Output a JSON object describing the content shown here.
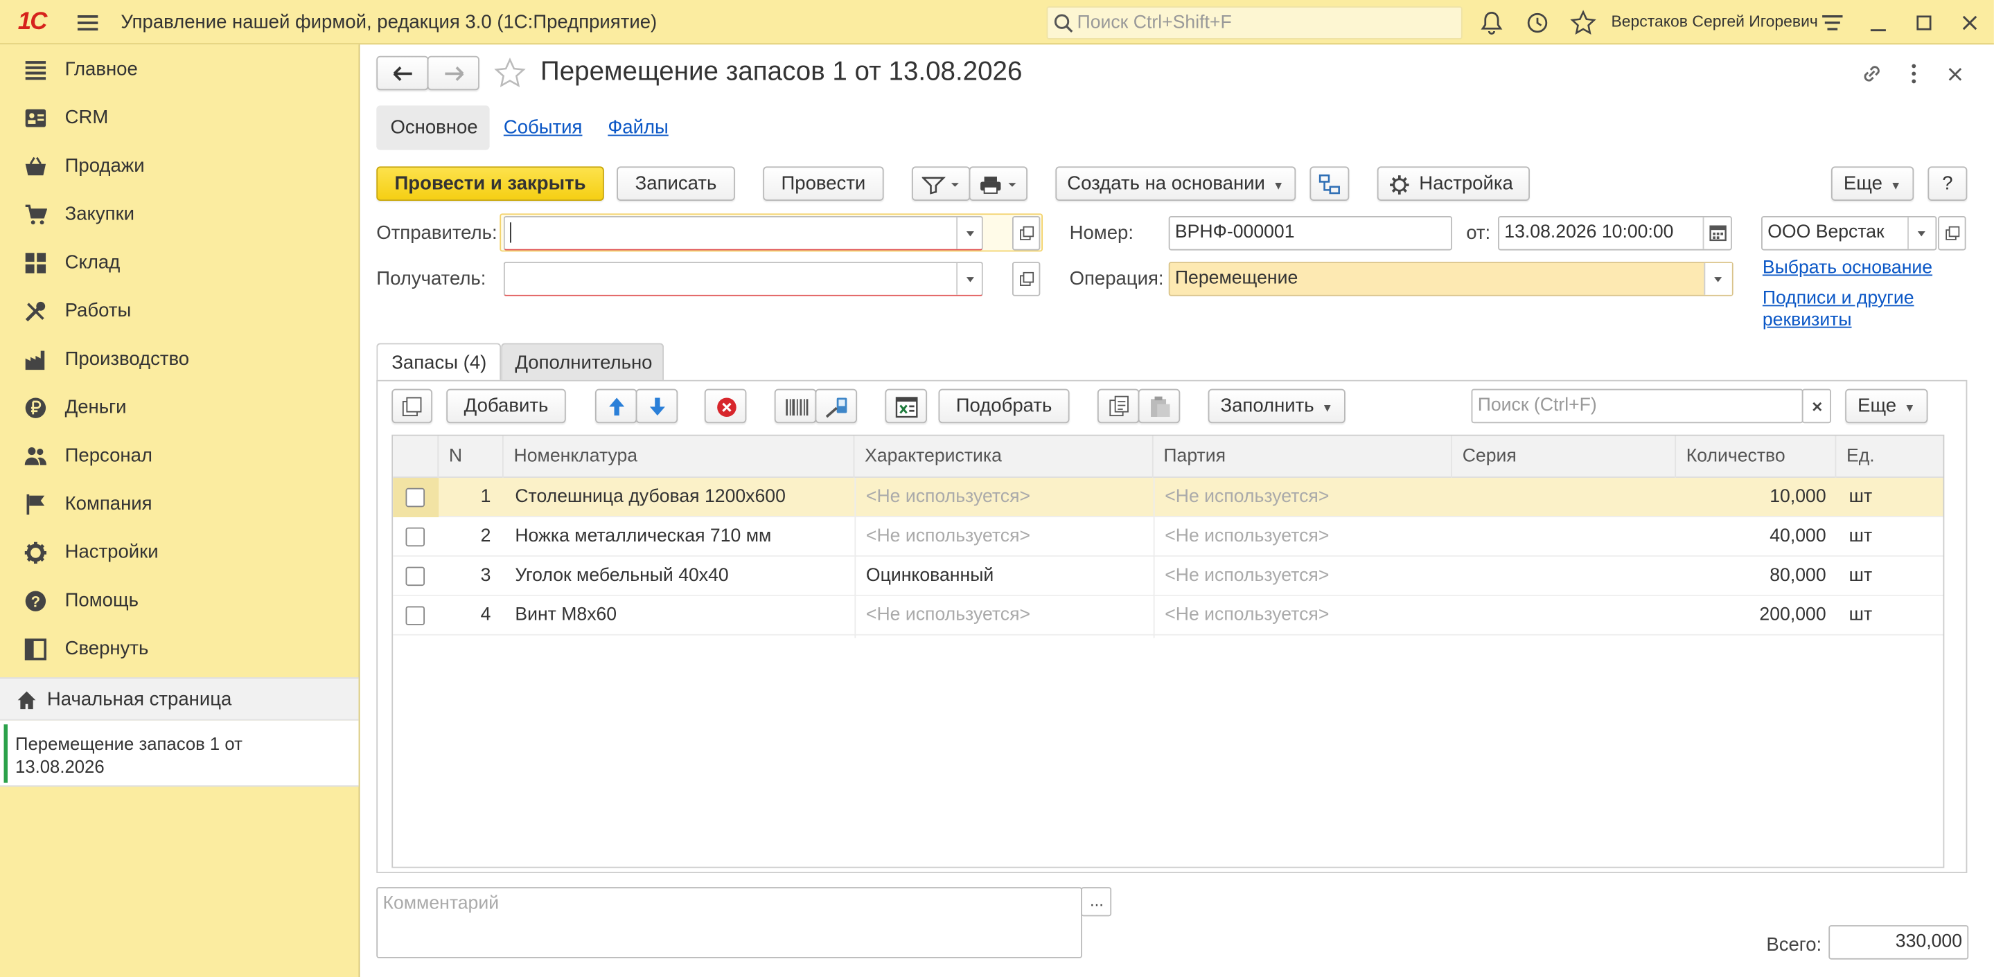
{
  "app": {
    "logo": "1С",
    "title": "Управление нашей фирмой, редакция 3.0  (1С:Предприятие)",
    "search_placeholder": "Поиск Ctrl+Shift+F",
    "user": "Верстаков Сергей Игоревич"
  },
  "sidebar": {
    "items": [
      {
        "label": "Главное",
        "icon": "list-icon"
      },
      {
        "label": "CRM",
        "icon": "contact-card-icon"
      },
      {
        "label": "Продажи",
        "icon": "basket-icon"
      },
      {
        "label": "Закупки",
        "icon": "cart-icon"
      },
      {
        "label": "Склад",
        "icon": "warehouse-grid-icon"
      },
      {
        "label": "Работы",
        "icon": "tools-icon"
      },
      {
        "label": "Производство",
        "icon": "factory-icon"
      },
      {
        "label": "Деньги",
        "icon": "ruble-coin-icon"
      },
      {
        "label": "Персонал",
        "icon": "people-icon"
      },
      {
        "label": "Компания",
        "icon": "flag-icon"
      },
      {
        "label": "Настройки",
        "icon": "gear-icon"
      },
      {
        "label": "Помощь",
        "icon": "help-icon"
      },
      {
        "label": "Свернуть",
        "icon": "collapse-panel-icon"
      }
    ],
    "home": "Начальная страница",
    "open_window": "Перемещение запасов 1 от 13.08.2026"
  },
  "doc": {
    "title": "Перемещение запасов 1 от 13.08.2026",
    "tabs": [
      "Основное",
      "События",
      "Файлы"
    ],
    "toolbar": {
      "post_close": "Провести и закрыть",
      "save": "Записать",
      "post": "Провести",
      "create_based": "Создать на основании",
      "settings": "Настройка",
      "more": "Еще",
      "help": "?"
    },
    "fields": {
      "sender_label": "Отправитель:",
      "sender_value": "",
      "receiver_label": "Получатель:",
      "receiver_value": "",
      "number_label": "Номер:",
      "number_value": "ВРНФ-000001",
      "date_label": "от:",
      "date_value": "13.08.2026 10:00:00",
      "operation_label": "Операция:",
      "operation_value": "Перемещение",
      "org_value": "ООО Верстак"
    },
    "links": {
      "choose_basis": "Выбрать основание",
      "signatures": "Подписи и другие реквизиты"
    },
    "subtabs": [
      "Запасы (4)",
      "Дополнительно"
    ],
    "table_toolbar": {
      "add": "Добавить",
      "pick": "Подобрать",
      "fill": "Заполнить",
      "search_placeholder": "Поиск (Ctrl+F)",
      "more": "Еще"
    },
    "columns": [
      "N",
      "Номенклатура",
      "Характеристика",
      "Партия",
      "Серия",
      "Количество",
      "Ед."
    ],
    "rows": [
      {
        "n": "1",
        "item": "Столешница дубовая 1200х600",
        "char": "<Не используется>",
        "batch": "<Не используется>",
        "series": "",
        "qty": "10,000",
        "unit": "шт"
      },
      {
        "n": "2",
        "item": "Ножка металлическая 710 мм",
        "char": "<Не используется>",
        "batch": "<Не используется>",
        "series": "",
        "qty": "40,000",
        "unit": "шт"
      },
      {
        "n": "3",
        "item": "Уголок мебельный 40х40",
        "char": "Оцинкованный",
        "batch": "<Не используется>",
        "series": "",
        "qty": "80,000",
        "unit": "шт"
      },
      {
        "n": "4",
        "item": "Винт М8х60",
        "char": "<Не используется>",
        "batch": "<Не используется>",
        "series": "",
        "qty": "200,000",
        "unit": "шт"
      }
    ],
    "comment_placeholder": "Комментарий",
    "total_label": "Всего:",
    "total_value": "330,000"
  },
  "colors": {
    "panel": "#fbeca0",
    "accent_button": "#f5cf14",
    "link": "#0b57c6",
    "selected_row": "#fbf1c8"
  }
}
